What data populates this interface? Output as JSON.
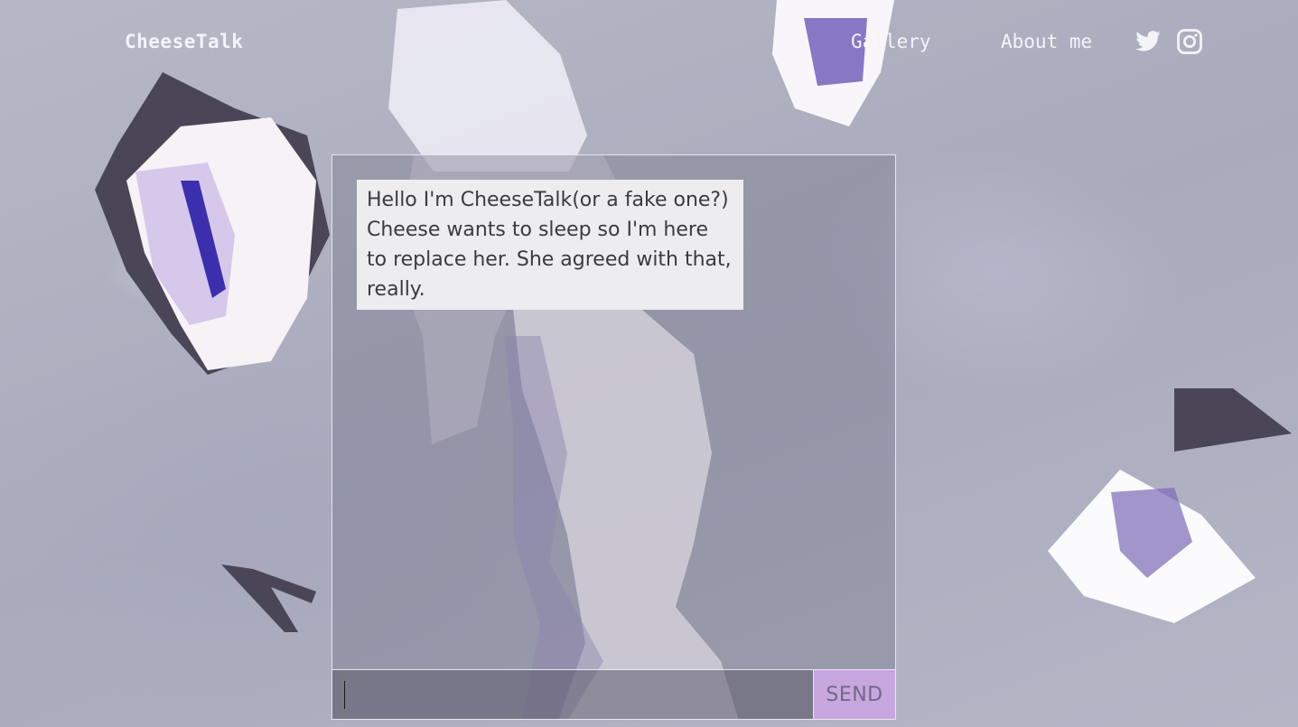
{
  "nav": {
    "brand": "CheeseTalk",
    "links": [
      {
        "label": "Gallery"
      },
      {
        "label": "About me"
      }
    ],
    "social": [
      "twitter-icon",
      "instagram-icon"
    ]
  },
  "chat": {
    "bot_message": "Hello I'm CheeseTalk(or a fake one?) Cheese wants to sleep so I'm here to replace her. She agreed with that, really.",
    "input_value": "",
    "input_placeholder": "",
    "send_label": "SEND"
  },
  "colors": {
    "background": "#aeb0c0",
    "bubble": "#ededef",
    "send_button": "#c8a6de",
    "nav_text": "#f4f4f8"
  }
}
